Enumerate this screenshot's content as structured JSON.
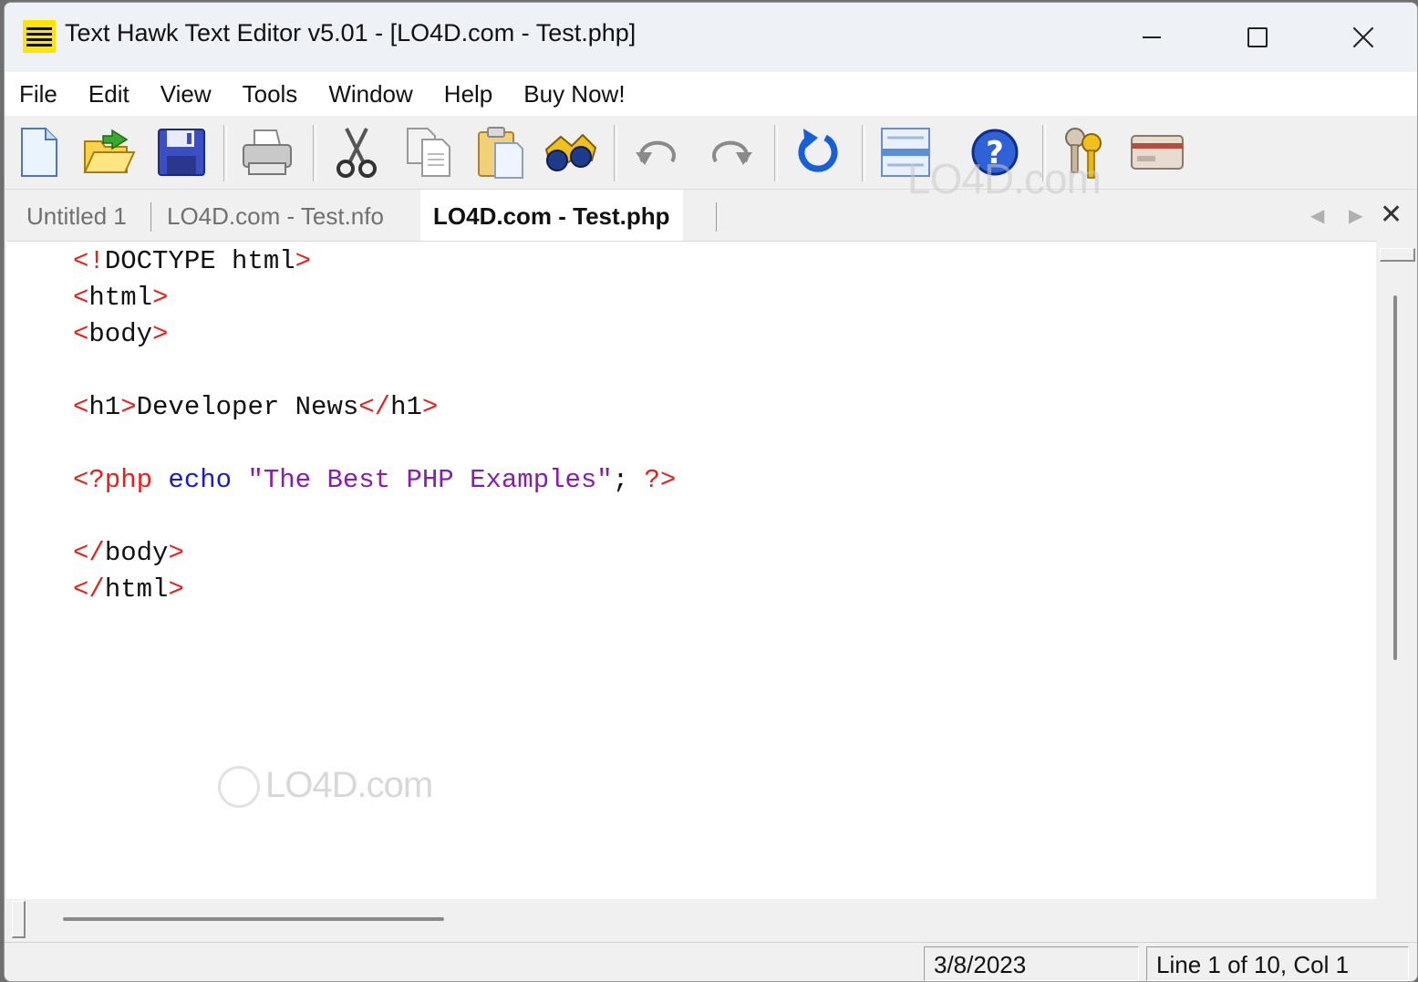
{
  "window": {
    "title": "Text Hawk Text Editor v5.01 - [LO4D.com - Test.php]"
  },
  "menu": [
    "File",
    "Edit",
    "View",
    "Tools",
    "Window",
    "Help",
    "Buy Now!"
  ],
  "toolbar": {
    "buttons": [
      {
        "name": "new-document",
        "glyph": "🗋"
      },
      {
        "name": "open-folder",
        "glyph": "📂"
      },
      {
        "name": "save",
        "glyph": "💾"
      },
      {
        "name": "print",
        "glyph": "🖶"
      },
      {
        "name": "cut",
        "glyph": "✂"
      },
      {
        "name": "copy",
        "glyph": "❐"
      },
      {
        "name": "paste",
        "glyph": "📋"
      },
      {
        "name": "find",
        "glyph": "🔭"
      },
      {
        "name": "undo",
        "glyph": "↶"
      },
      {
        "name": "redo",
        "glyph": "↷"
      },
      {
        "name": "refresh",
        "glyph": "↺"
      },
      {
        "name": "layout",
        "glyph": "▤"
      },
      {
        "name": "help",
        "glyph": "?"
      },
      {
        "name": "register-keys",
        "glyph": "🔑"
      },
      {
        "name": "credit-card",
        "glyph": "💳"
      }
    ]
  },
  "tabs": [
    {
      "label": "Untitled 1",
      "active": false
    },
    {
      "label": "LO4D.com - Test.nfo",
      "active": false
    },
    {
      "label": "LO4D.com - Test.php",
      "active": true
    }
  ],
  "tab_nav": {
    "prev": "◀",
    "next": "▶",
    "close": "✕"
  },
  "editor": {
    "lines": [
      [
        {
          "t": "<!",
          "c": "tag"
        },
        {
          "t": "DOCTYPE html",
          "c": "txt"
        },
        {
          "t": ">",
          "c": "tag"
        }
      ],
      [
        {
          "t": "<",
          "c": "tag"
        },
        {
          "t": "html",
          "c": "txt"
        },
        {
          "t": ">",
          "c": "tag"
        }
      ],
      [
        {
          "t": "<",
          "c": "tag"
        },
        {
          "t": "body",
          "c": "txt"
        },
        {
          "t": ">",
          "c": "tag"
        }
      ],
      [],
      [
        {
          "t": "<",
          "c": "tag"
        },
        {
          "t": "h1",
          "c": "txt"
        },
        {
          "t": ">",
          "c": "tag"
        },
        {
          "t": "Developer News",
          "c": "txt"
        },
        {
          "t": "</",
          "c": "tag"
        },
        {
          "t": "h1",
          "c": "txt"
        },
        {
          "t": ">",
          "c": "tag"
        }
      ],
      [],
      [
        {
          "t": "<?php ",
          "c": "tag"
        },
        {
          "t": "echo ",
          "c": "kw"
        },
        {
          "t": "\"The Best PHP Examples\"",
          "c": "str"
        },
        {
          "t": "; ",
          "c": "txt"
        },
        {
          "t": "?>",
          "c": "tag"
        }
      ],
      [],
      [
        {
          "t": "</",
          "c": "tag"
        },
        {
          "t": "body",
          "c": "txt"
        },
        {
          "t": ">",
          "c": "tag"
        }
      ],
      [
        {
          "t": "</",
          "c": "tag"
        },
        {
          "t": "html",
          "c": "txt"
        },
        {
          "t": ">",
          "c": "tag"
        }
      ]
    ]
  },
  "watermark": {
    "text": "LO4D.com"
  },
  "status": {
    "date": "3/8/2023",
    "position": "Line 1 of 10, Col 1"
  }
}
